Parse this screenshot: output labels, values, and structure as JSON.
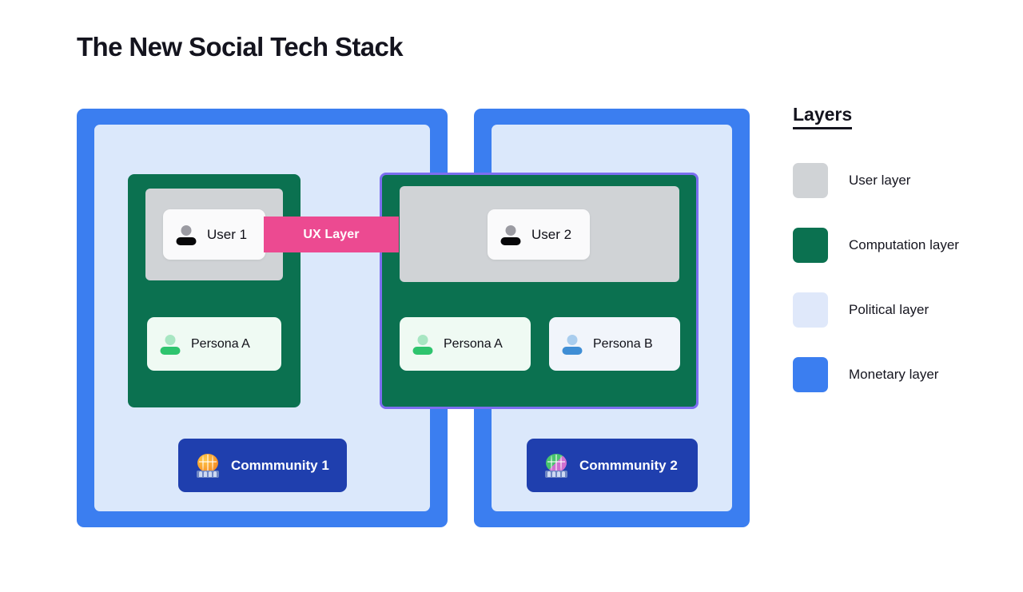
{
  "page": {
    "title": "The New Social Tech Stack",
    "background": "#ffffff"
  },
  "colors": {
    "user_layer": "#d0d3d6",
    "computation_layer": "#0b7150",
    "political_layer": "#dbe8fb",
    "monetary_layer": "#3b7ef0",
    "ux_layer": "#ec4a91",
    "community_button": "#1f3fae",
    "selection_outline": "#7c6ef0",
    "title_text": "#14141e"
  },
  "diagram": {
    "ux_band": {
      "label": "UX Layer"
    },
    "left_column": {
      "user_chip": {
        "label": "User 1",
        "avatar": "user-avatar-icon"
      },
      "personas": [
        {
          "label": "Persona A",
          "avatar": "persona-green-avatar-icon"
        }
      ],
      "community_button": {
        "label": "Commmunity 1",
        "icon": "globe-orange-icon"
      }
    },
    "right_column": {
      "selected": true,
      "user_chip": {
        "label": "User 2",
        "avatar": "user-avatar-icon"
      },
      "personas": [
        {
          "label": "Persona A",
          "avatar": "persona-green-avatar-icon"
        },
        {
          "label": "Persona B",
          "avatar": "persona-blue-avatar-icon"
        }
      ],
      "community_button": {
        "label": "Commmunity 2",
        "icon": "globe-green-icon"
      }
    }
  },
  "legend": {
    "title": "Layers",
    "items": [
      {
        "label": "User layer",
        "color": "#d0d3d6"
      },
      {
        "label": "Computation layer",
        "color": "#0b7150"
      },
      {
        "label": "Political layer",
        "color": "#dbe8fb"
      },
      {
        "label": "Monetary layer",
        "color": "#3b7ef0"
      }
    ]
  }
}
